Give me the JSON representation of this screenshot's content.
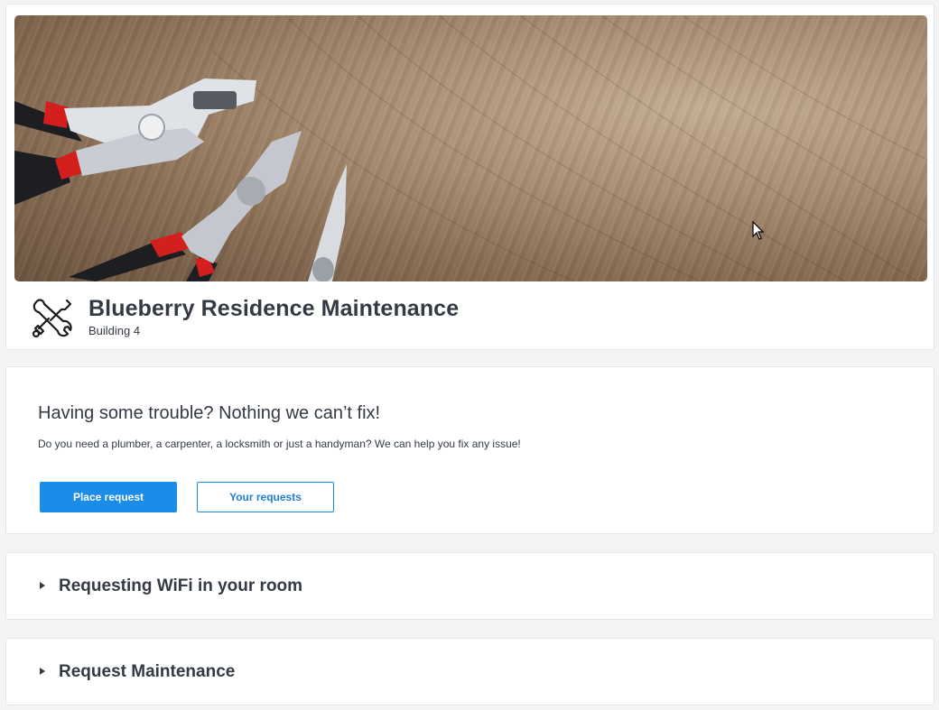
{
  "header": {
    "title": "Blueberry Residence Maintenance",
    "subtitle": "Building 4",
    "icon": "wrench-screwdriver-icon",
    "banner_image": "pliers-on-wood"
  },
  "intro": {
    "heading": "Having some trouble? Nothing we can’t fix!",
    "text": "Do you need a plumber, a carpenter, a locksmith or just a handyman? We can help you fix any issue!",
    "primary_button": "Place request",
    "secondary_button": "Your requests"
  },
  "sections": [
    {
      "title": "Requesting WiFi in your room",
      "expanded": false
    },
    {
      "title": "Request Maintenance",
      "expanded": false
    }
  ],
  "colors": {
    "accent": "#1b8ce8",
    "text": "#333a44",
    "background": "#f3f4f5"
  }
}
